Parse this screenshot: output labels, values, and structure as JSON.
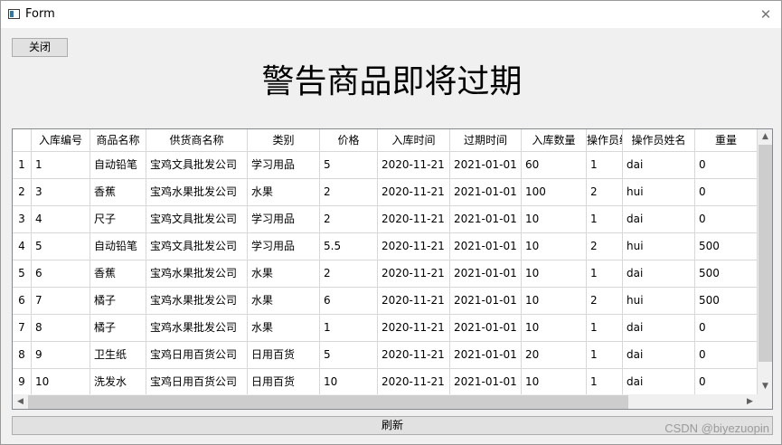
{
  "window": {
    "title": "Form",
    "close_glyph": "✕"
  },
  "toolbar": {
    "close_label": "关闭"
  },
  "page": {
    "heading": "警告商品即将过期"
  },
  "table": {
    "columns": [
      "入库编号",
      "商品名称",
      "供货商名称",
      "类别",
      "价格",
      "入库时间",
      "过期时间",
      "入库数量",
      "操作员编号",
      "操作员姓名",
      "重量"
    ],
    "row_headers": [
      "1",
      "2",
      "3",
      "4",
      "5",
      "6",
      "7",
      "8",
      "9"
    ],
    "rows": [
      [
        "1",
        "自动铅笔",
        "宝鸡文具批发公司",
        "学习用品",
        "5",
        "2020-11-21",
        "2021-01-01",
        "60",
        "1",
        "dai",
        "0"
      ],
      [
        "3",
        "香蕉",
        "宝鸡水果批发公司",
        "水果",
        "2",
        "2020-11-21",
        "2021-01-01",
        "100",
        "2",
        "hui",
        "0"
      ],
      [
        "4",
        "尺子",
        "宝鸡文具批发公司",
        "学习用品",
        "2",
        "2020-11-21",
        "2021-01-01",
        "10",
        "1",
        "dai",
        "0"
      ],
      [
        "5",
        "自动铅笔",
        "宝鸡文具批发公司",
        "学习用品",
        "5.5",
        "2020-11-21",
        "2021-01-01",
        "10",
        "2",
        "hui",
        "500"
      ],
      [
        "6",
        "香蕉",
        "宝鸡水果批发公司",
        "水果",
        "2",
        "2020-11-21",
        "2021-01-01",
        "10",
        "1",
        "dai",
        "500"
      ],
      [
        "7",
        "橘子",
        "宝鸡水果批发公司",
        "水果",
        "6",
        "2020-11-21",
        "2021-01-01",
        "10",
        "2",
        "hui",
        "500"
      ],
      [
        "8",
        "橘子",
        "宝鸡水果批发公司",
        "水果",
        "1",
        "2020-11-21",
        "2021-01-01",
        "10",
        "1",
        "dai",
        "0"
      ],
      [
        "9",
        "卫生纸",
        "宝鸡日用百货公司",
        "日用百货",
        "5",
        "2020-11-21",
        "2021-01-01",
        "20",
        "1",
        "dai",
        "0"
      ],
      [
        "10",
        "洗发水",
        "宝鸡日用百货公司",
        "日用百货",
        "10",
        "2020-11-21",
        "2021-01-01",
        "10",
        "1",
        "dai",
        "0"
      ]
    ]
  },
  "scrollbars": {
    "up": "▲",
    "down": "▼",
    "left": "◀",
    "right": "▶"
  },
  "footer": {
    "refresh_label": "刷新",
    "watermark": "CSDN @biyezuopin"
  }
}
